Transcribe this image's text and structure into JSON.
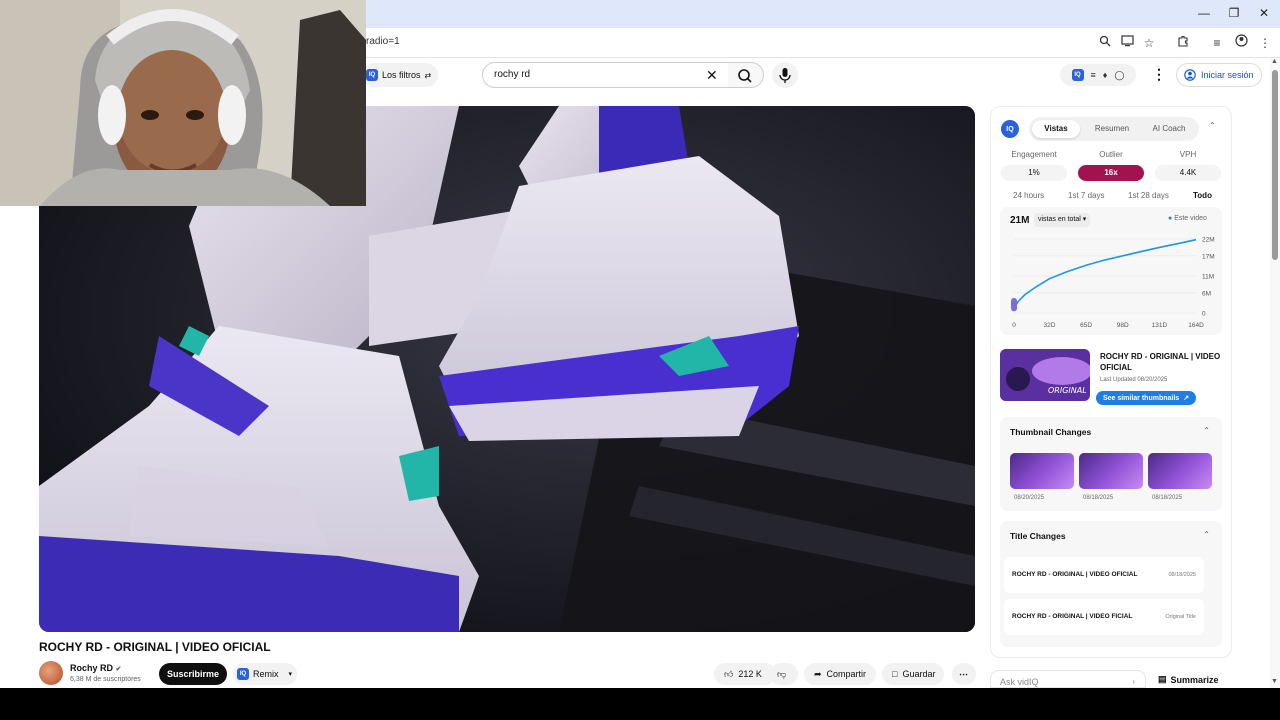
{
  "browser": {
    "url_fragment": "radio=1",
    "window_controls": [
      "minimize-icon",
      "restore-icon",
      "close-icon"
    ],
    "toolbar_icons": [
      "zoom-icon",
      "cast-icon",
      "star-icon",
      "extensions-icon",
      "media-icon",
      "profile-icon",
      "more-icon"
    ]
  },
  "header": {
    "filters_label": "Los filtros",
    "search_value": "rochy rd",
    "sign_in_label": "Iniciar sesión"
  },
  "video": {
    "title": "ROCHY RD - ORIGINAL | VIDEO OFICIAL",
    "channel_name": "Rochy RD",
    "subscribers": "6,38 M de suscriptores",
    "subscribe_label": "Suscribirme",
    "remix_label": "Remix",
    "likes": "212 K",
    "share_label": "Compartir",
    "save_label": "Guardar"
  },
  "panel": {
    "logo": "IQ",
    "tabs": [
      "Vistas",
      "Resumen",
      "AI Coach"
    ],
    "active_tab": "Vistas",
    "metrics": [
      {
        "label": "Engagement",
        "value": "1%"
      },
      {
        "label": "Outlier",
        "value": "16x"
      },
      {
        "label": "VPH",
        "value": "4.4K"
      }
    ],
    "ranges": [
      "24 hours",
      "1st 7 days",
      "1st 28 days",
      "Todo"
    ],
    "active_range": "Todo",
    "chart_total": "21M",
    "chart_select": "vistas en total",
    "legend": "Este video",
    "card": {
      "title": "ROCHY RD - ORIGINAL | VIDEO OFICIAL",
      "updated": "Last Updated 08/20/2025",
      "button": "See similar thumbnails",
      "thumb_text": "ORIGINAL"
    },
    "thumbnail_changes": {
      "title": "Thumbnail Changes",
      "dates": [
        "08/20/2025",
        "08/18/2025",
        "08/18/2025"
      ]
    },
    "title_changes": {
      "title": "Title Changes",
      "rows": [
        {
          "title": "ROCHY RD - ORIGINAL | VIDEO OFICIAL",
          "date": "08/18/2025"
        },
        {
          "title": "ROCHY RD - ORIGINAL | VIDEO FICIAL",
          "date": "Original Title"
        }
      ]
    },
    "ask_placeholder": "Ask vidIQ",
    "summarize_label": "Summarize"
  },
  "chart_data": {
    "type": "line",
    "x_tick_labels": [
      "0",
      "32D",
      "65D",
      "98D",
      "131D",
      "164D"
    ],
    "y_tick_labels": [
      "22M",
      "17M",
      "11M",
      "6M",
      "0"
    ],
    "xlim": [
      0,
      164
    ],
    "ylim": [
      0,
      22
    ],
    "series": [
      {
        "name": "Este video",
        "color": "#1a9ad6",
        "x": [
          0,
          4,
          10,
          20,
          32,
          48,
          65,
          80,
          98,
          115,
          131,
          150,
          164
        ],
        "y": [
          1.5,
          3.5,
          5.5,
          7.8,
          10.2,
          12.3,
          14.2,
          15.6,
          17.0,
          18.3,
          19.5,
          20.8,
          21.8
        ]
      }
    ]
  }
}
